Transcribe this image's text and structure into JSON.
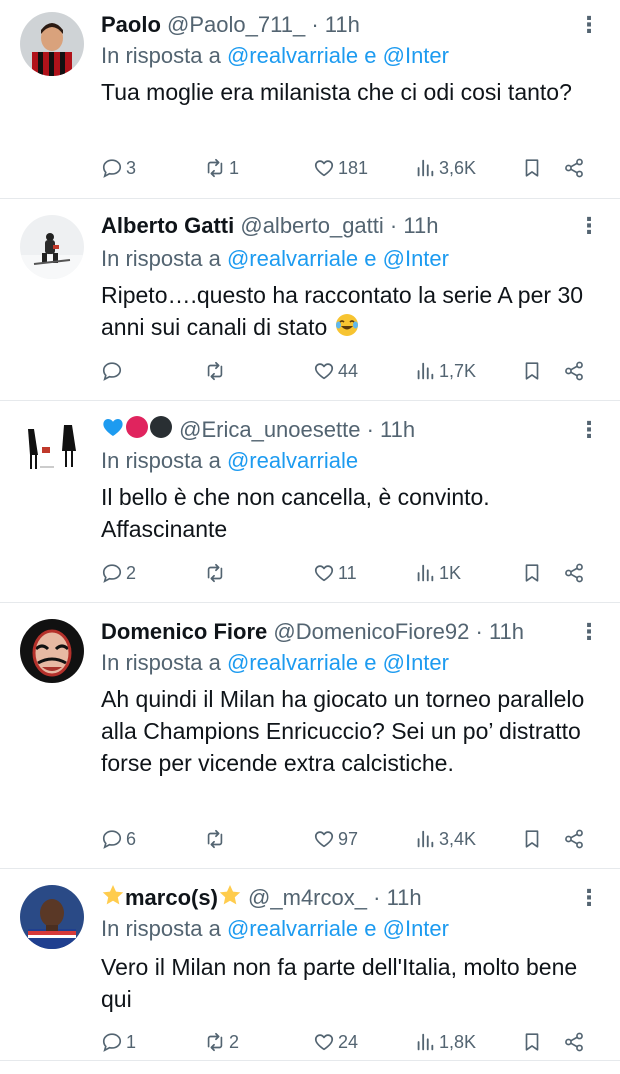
{
  "tweets": [
    {
      "name": "Paolo",
      "handle": "@Paolo_711_",
      "sep": "·",
      "time": "11h",
      "reply_prefix": "In risposta a",
      "reply_to_1": "@realvarriale",
      "reply_joiner": "e",
      "reply_to_2": "@Inter",
      "text": "Tua moglie era milanista che ci odi cosi tanto?",
      "replies": "3",
      "retweets": "1",
      "likes": "181",
      "views": "3,6K",
      "avatar": "player-red-black-shirt"
    },
    {
      "name": "Alberto Gatti",
      "handle": "@alberto_gatti",
      "sep": "·",
      "time": "11h",
      "reply_prefix": "In risposta a",
      "reply_to_1": "@realvarriale",
      "reply_joiner": "e",
      "reply_to_2": "@Inter",
      "text": "Ripeto….questo ha raccontato la serie A per 30 anni sui canali di stato",
      "text_emoji": "tears-of-joy",
      "replies": "",
      "retweets": "",
      "likes": "44",
      "views": "1,7K",
      "avatar": "skier-in-snow"
    },
    {
      "name_emojis": [
        "blue-heart",
        "red-circle",
        "black-circle"
      ],
      "handle": "@Erica_unoesette",
      "sep": "·",
      "time": "11h",
      "reply_prefix": "In risposta a",
      "reply_to_1": "@realvarriale",
      "text": "Il bello è che non cancella, è convinto. Affascinante",
      "replies": "2",
      "retweets": "",
      "likes": "11",
      "views": "1K",
      "avatar": "fashion-figures"
    },
    {
      "name": "Domenico Fiore",
      "handle": "@DomenicoFiore92",
      "sep": "·",
      "time": "11h",
      "reply_prefix": "In risposta a",
      "reply_to_1": "@realvarriale",
      "reply_joiner": "e",
      "reply_to_2": "@Inter",
      "text": "Ah quindi il Milan ha giocato un torneo parallelo alla Champions Enricuccio? Sei un po’ distratto forse per vicende extra calcistiche.",
      "replies": "6",
      "retweets": "",
      "likes": "97",
      "views": "3,4K",
      "avatar": "dali-mask"
    },
    {
      "name": "marco(s)",
      "name_emoji": "star",
      "handle": "@_m4rcox_",
      "sep": "·",
      "time": "11h",
      "reply_prefix": "In risposta a",
      "reply_to_1": "@realvarriale",
      "reply_joiner": "e",
      "reply_to_2": "@Inter",
      "text": "Vero il Milan non fa parte dell'Italia, molto bene qui",
      "replies": "1",
      "retweets": "2",
      "likes": "24",
      "views": "1,8K",
      "avatar": "player-france-shirt"
    }
  ],
  "colors": {
    "accent": "#1d9bf0",
    "muted": "#536471",
    "text": "#0f1419",
    "divider": "#e6e9ec"
  },
  "icons": [
    "reply-icon",
    "retweet-icon",
    "like-icon",
    "views-icon",
    "bookmark-icon",
    "share-icon",
    "more-icon"
  ]
}
